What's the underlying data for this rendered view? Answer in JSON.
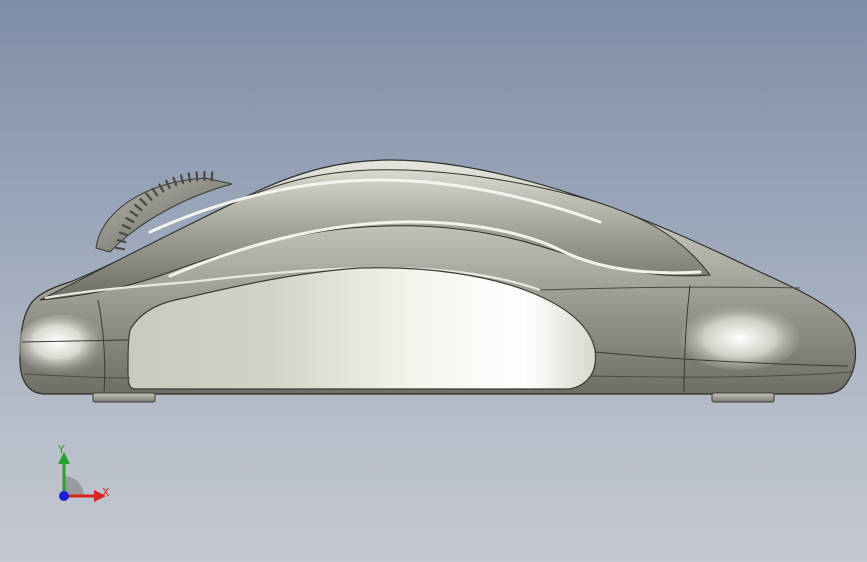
{
  "viewport": {
    "background_top_color": "#7f8ea8",
    "background_bottom_color": "#c4c8d1",
    "model_name_icon": "computer-mouse-side-view"
  },
  "triad": {
    "x_label": "X",
    "y_label": "Y",
    "x_color": "#d8261e",
    "y_color": "#23a42a",
    "z_color": "#1b1fd8"
  }
}
